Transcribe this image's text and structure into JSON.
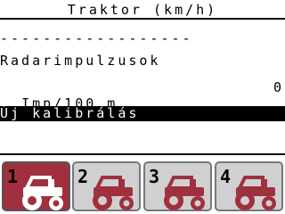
{
  "header": {
    "title": "Traktor (km/h)"
  },
  "separator": "------------------",
  "menu": {
    "radar_label": "Radarimpulzusok",
    "imp_label": "Imp/100 m",
    "imp_value": "0",
    "calibration_label": "Új kalibrálás"
  },
  "tabs": [
    {
      "number": "1",
      "icon": "tractor-icon",
      "active": true
    },
    {
      "number": "2",
      "icon": "tractor-icon",
      "active": false
    },
    {
      "number": "3",
      "icon": "tractor-icon",
      "active": false
    },
    {
      "number": "4",
      "icon": "tractor-icon",
      "active": false
    }
  ],
  "colors": {
    "active_tab": "#a0303d",
    "inactive_tab": "#d0d0d0",
    "tractor_active": "#ffffff",
    "tractor_inactive": "#a0303d",
    "highlight": "#000000"
  }
}
